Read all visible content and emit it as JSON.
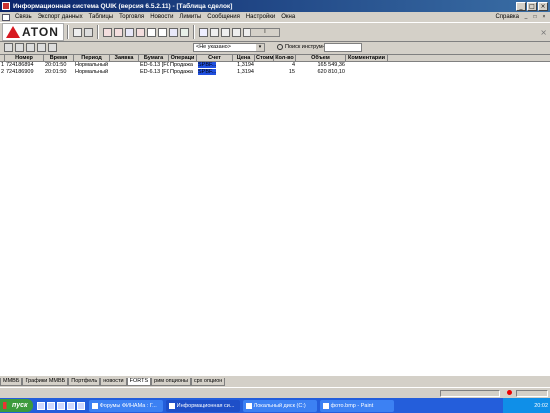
{
  "window": {
    "title": "Информационная система QUIK (версия 6.5.2.11) - [Таблица сделок]",
    "buttons": [
      "_",
      "□",
      "×"
    ]
  },
  "menu": {
    "items": [
      "Связь",
      "Экспорт данных",
      "Таблицы",
      "Торговля",
      "Новости",
      "Лимиты",
      "Сообщения",
      "Настройки",
      "Окна"
    ],
    "help": "Справка",
    "mdi_buttons": [
      "_",
      "□",
      "×"
    ]
  },
  "toolbar": {
    "brand": "ATON",
    "field": "I",
    "close_glyph": "×"
  },
  "filter": {
    "select_value": "<Не указано>",
    "select_arrow": "▾",
    "search_label": "Поиск инструм-та"
  },
  "table": {
    "columns": [
      "Номер",
      "Время",
      "Период",
      "Заявка",
      "Бумага",
      "Операци",
      "Счет",
      "Цена",
      "Стоими",
      "Кол-во",
      "Объем",
      "Комментарии"
    ],
    "rows": [
      {
        "idx": "1",
        "number": "724186894",
        "time": "20:01:50",
        "period": "Нормальный",
        "order": "",
        "security": "ED-6.13 [FOF",
        "operation": "Продажа",
        "account": "SPBF...",
        "price": "1,3194",
        "cost": "",
        "qty": "4",
        "volume": "165 549,36",
        "comment": ""
      },
      {
        "idx": "2",
        "number": "724186909",
        "time": "20:01:50",
        "period": "Нормальный",
        "order": "",
        "security": "ED-6.13 [FOF",
        "operation": "Продажа",
        "account": "SPBF...",
        "price": "1,3194",
        "cost": "",
        "qty": "15",
        "volume": "620 810,10",
        "comment": ""
      }
    ]
  },
  "tabs": [
    "ММВБ",
    "Графики ММВБ",
    "Портфель",
    "новости",
    "FORTS",
    "рим опционы",
    "срх опцион"
  ],
  "active_tab": "FORTS",
  "taskbar": {
    "start": "пуск",
    "tasks": [
      "Форумы ФИНАМа : Г...",
      "Информационная си...",
      "Локальный диск (C:)",
      "фото.bmp - Paint"
    ],
    "clock": "20:02"
  },
  "colors": {
    "title_bar": "#0a246a",
    "window_bg": "#d4d0c8",
    "logo_red": "#d71920",
    "account_mask": "#2050e0",
    "taskbar": "#245edb"
  }
}
